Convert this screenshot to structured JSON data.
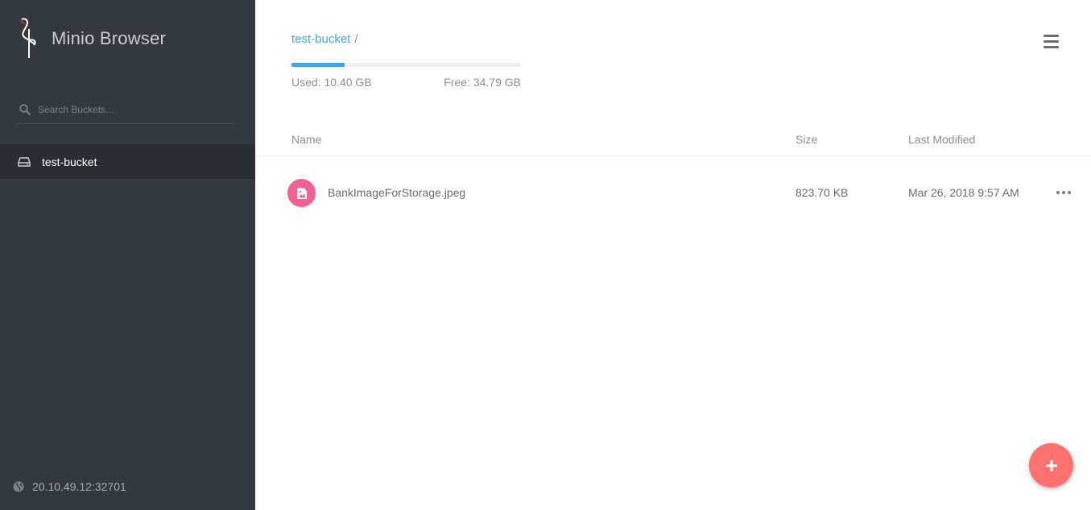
{
  "app": {
    "title": "Minio Browser"
  },
  "sidebar": {
    "search": {
      "placeholder": "Search Buckets..."
    },
    "buckets": [
      {
        "label": "test-bucket",
        "icon": "hard-drive-icon",
        "active": true
      }
    ],
    "host": "20.10.49.12:32701"
  },
  "breadcrumb": {
    "bucket": "test-bucket",
    "separator": "/"
  },
  "usage": {
    "used": "Used: 10.40 GB",
    "free": "Free: 34.79 GB",
    "fill_fraction": 0.23
  },
  "table": {
    "headers": {
      "name": "Name",
      "size": "Size",
      "last_modified": "Last Modified"
    },
    "rows": [
      {
        "name": "BankImageForStorage.jpeg",
        "size": "823.70 KB",
        "last_modified": "Mar 26, 2018 9:57 AM",
        "icon": "image-file-icon"
      }
    ]
  },
  "colors": {
    "sidebar_bg": "#32393f",
    "accent_blue": "#46a5e0",
    "file_icon_pink": "#f06292",
    "fab_red": "#ff726f"
  }
}
